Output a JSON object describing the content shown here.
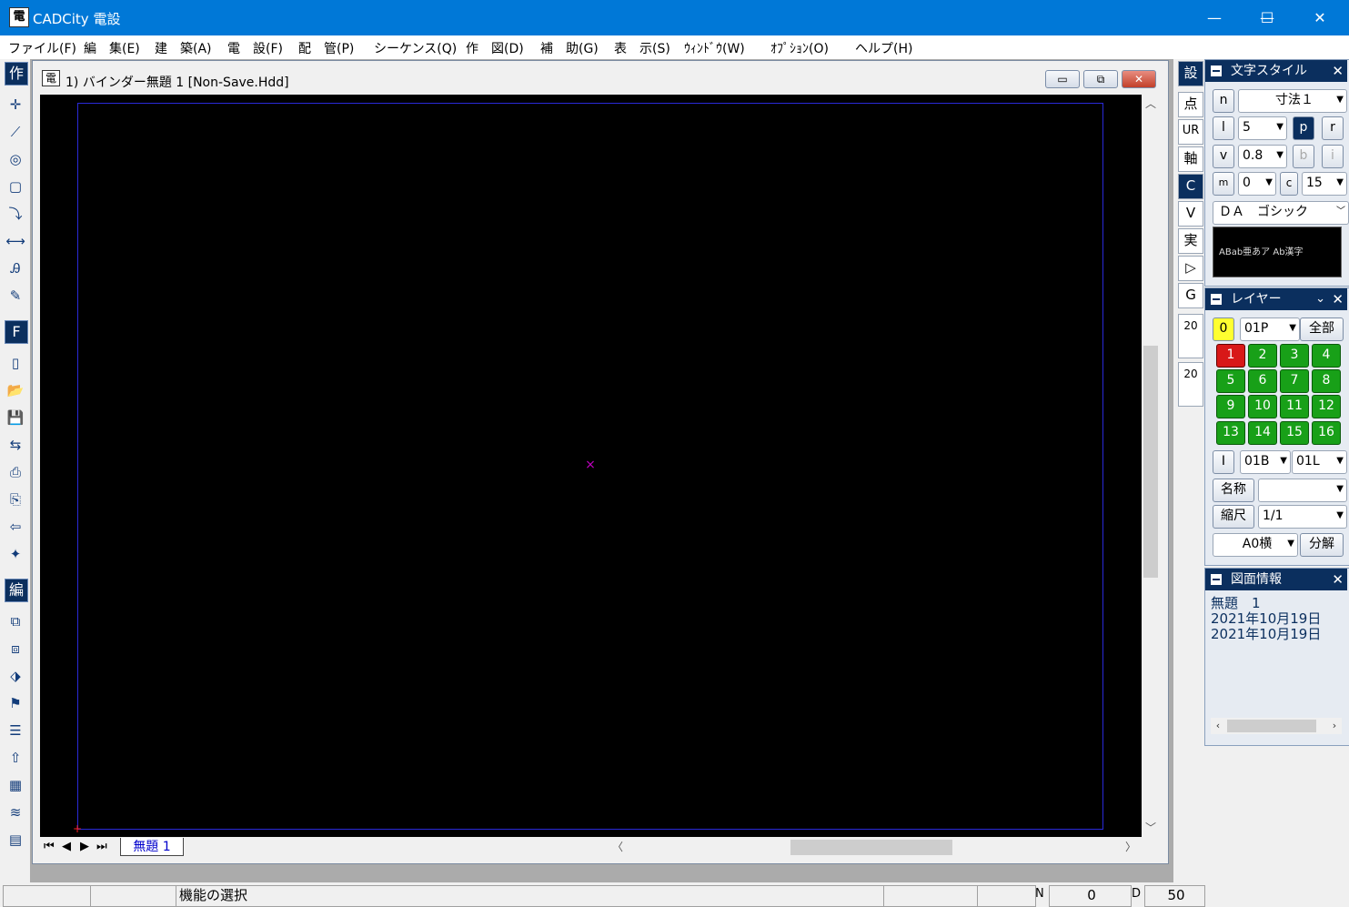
{
  "window": {
    "title": "CADCity 電設",
    "app_icon_glyph": "電",
    "controls": {
      "minimize": "—",
      "maximize": "☐",
      "close": "✕"
    }
  },
  "menu": [
    "ファイル(F)",
    "編　集(E)",
    "建　築(A)",
    "電　設(F)",
    "配　管(P)",
    "シーケンス(Q)",
    "作　図(D)",
    "補　助(G)",
    "表　示(S)",
    "ｳｨﾝﾄﾞｳ(W)",
    "ｵﾌﾟｼｮﾝ(O)",
    "ヘルプ(H)"
  ],
  "left_toolbar": {
    "section_create": "作",
    "section_file": "F",
    "section_edit": "編"
  },
  "document": {
    "title": "1) バインダー無題 1 [Non-Save.Hdd]",
    "icon_glyph": "電",
    "tab": "無題 1",
    "nav": [
      "⏮",
      "◀",
      "▶",
      "⏭"
    ],
    "center_mark": "×",
    "origin_mark": "+"
  },
  "mode_toolbar": [
    "設",
    "点",
    "UR",
    "軸",
    "C",
    "V",
    "実",
    "▷",
    "G",
    "20",
    "20"
  ],
  "text_style_panel": {
    "title": "文字スタイル",
    "n_label": "n",
    "style_name": "寸法１",
    "l_label": "l",
    "size": "5",
    "p_label": "p",
    "r_label": "r",
    "v_label": "v",
    "spacing": "0.8",
    "b_label": "b",
    "i_label": "i",
    "m_label": "m",
    "m_value": "0",
    "c_label": "c",
    "c_value": "15",
    "font": "ＤＡ　ゴシック",
    "preview": "ABab亜あア Ab漢字"
  },
  "layer_panel": {
    "title": "レイヤー",
    "current": "0",
    "current_name": "01P",
    "all_button": "全部",
    "layers": [
      "1",
      "2",
      "3",
      "4",
      "5",
      "6",
      "7",
      "8",
      "9",
      "10",
      "11",
      "12",
      "13",
      "14",
      "15",
      "16"
    ],
    "i_label": "I",
    "combo_b": "01B",
    "combo_l": "01L",
    "name_button": "名称",
    "name_value": "",
    "scale_button": "縮尺",
    "scale_value": "1/1",
    "paper": "A0横",
    "split_button": "分解"
  },
  "drawing_info_panel": {
    "title": "図面情報",
    "lines": [
      "無題　1",
      "2021年10月19日",
      "2021年10月19日"
    ]
  },
  "statusbar": {
    "message": "機能の選択",
    "n_label": "N",
    "n_value": "0",
    "d_label": "D",
    "d_value": "50"
  }
}
